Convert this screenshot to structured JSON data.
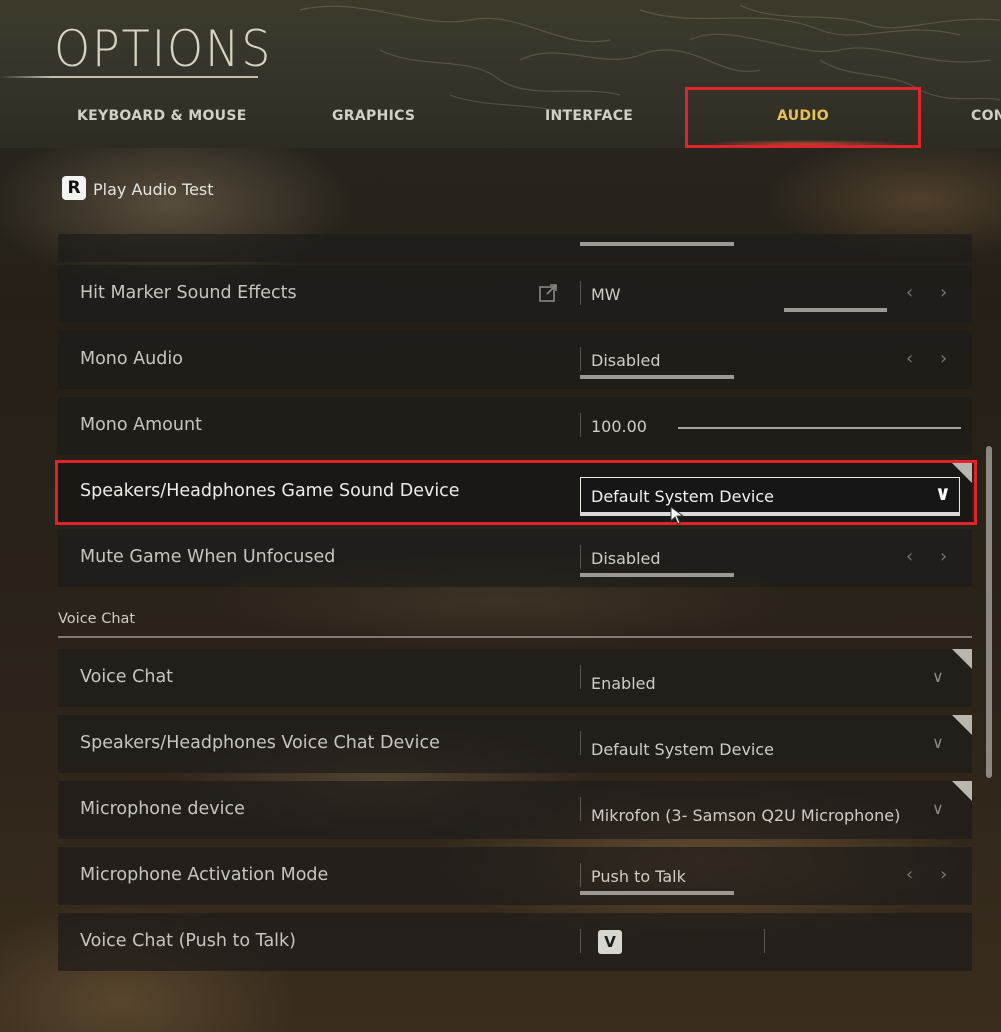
{
  "header": {
    "title": "OPTIONS",
    "tabs": [
      {
        "label": "KEYBOARD & MOUSE",
        "active": false
      },
      {
        "label": "GRAPHICS",
        "active": false
      },
      {
        "label": "INTERFACE",
        "active": false
      },
      {
        "label": "AUDIO",
        "active": true
      },
      {
        "label": "CON",
        "active": false
      }
    ]
  },
  "audio_test": {
    "key": "R",
    "label": "Play Audio Test"
  },
  "rows": [
    {
      "label": "Hit Marker Sound Effects",
      "value": "MW",
      "control": "arrows",
      "icon": "external-link-icon"
    },
    {
      "label": "Mono Audio",
      "value": "Disabled",
      "control": "arrows"
    },
    {
      "label": "Mono Amount",
      "value": "100.00",
      "control": "slider"
    },
    {
      "label": "Speakers/Headphones Game Sound Device",
      "value": "Default System Device",
      "control": "dropdown-open"
    },
    {
      "label": "Mute Game When Unfocused",
      "value": "Disabled",
      "control": "arrows"
    }
  ],
  "voice_chat": {
    "section_label": "Voice Chat",
    "rows": [
      {
        "label": "Voice Chat",
        "value": "Enabled",
        "control": "dropdown"
      },
      {
        "label": "Speakers/Headphones Voice Chat Device",
        "value": "Default System Device",
        "control": "dropdown"
      },
      {
        "label": "Microphone device",
        "value": "Mikrofon (3- Samson Q2U Microphone)",
        "control": "dropdown"
      },
      {
        "label": "Microphone Activation Mode",
        "value": "Push to Talk",
        "control": "arrows"
      },
      {
        "label": "Voice Chat (Push to Talk)",
        "value": "V",
        "control": "keybind"
      }
    ]
  },
  "icons": {
    "left_arrow": "‹",
    "right_arrow": "›",
    "chevron_down": "∨",
    "dropdown_chevron": "∨"
  },
  "colors": {
    "accent_active_tab": "#e8c15a",
    "highlight_red": "#e0242c"
  }
}
